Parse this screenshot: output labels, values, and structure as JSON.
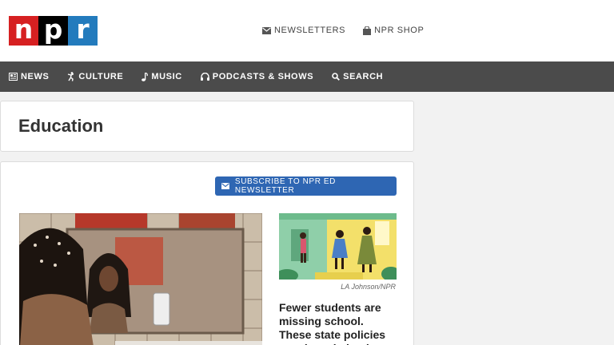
{
  "header": {
    "logo_letters": [
      "n",
      "p",
      "r"
    ],
    "links": [
      {
        "label": "NEWSLETTERS",
        "icon": "envelope-icon"
      },
      {
        "label": "NPR SHOP",
        "icon": "shopping-bag-icon"
      }
    ]
  },
  "nav": {
    "items": [
      {
        "label": "NEWS",
        "icon": "newspaper-icon"
      },
      {
        "label": "CULTURE",
        "icon": "dancer-icon"
      },
      {
        "label": "MUSIC",
        "icon": "music-note-icon"
      },
      {
        "label": "PODCASTS & SHOWS",
        "icon": "headphones-icon"
      },
      {
        "label": "SEARCH",
        "icon": "search-icon"
      }
    ]
  },
  "page": {
    "title": "Education"
  },
  "main": {
    "subscribe_label": "SUBSCRIBE TO NPR ED NEWSLETTER",
    "subscribe_icon": "envelope-icon",
    "story": {
      "image_credit": "LA Johnson/NPR",
      "headline": "Fewer students are missing school. These state policies may have helped"
    }
  },
  "colors": {
    "logo_n": "#d62021",
    "logo_p": "#000000",
    "logo_r": "#237bbd",
    "nav_bg": "#4b4b4b",
    "button": "#2e66b3"
  }
}
